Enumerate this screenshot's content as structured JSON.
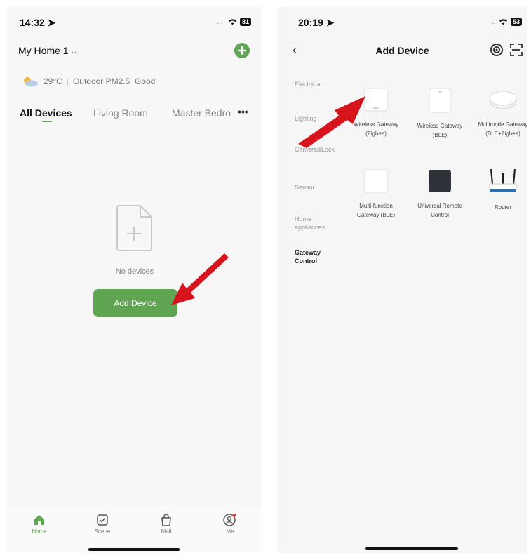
{
  "phone1": {
    "status": {
      "time": "14:32",
      "signal": "....",
      "battery": "81"
    },
    "home_name": "My Home 1",
    "weather": {
      "temperature": "29°C",
      "air_quality": "Outdoor PM2.5  Good"
    },
    "tabs": [
      "All Devices",
      "Living Room",
      "Master Bedro"
    ],
    "empty_text": "No devices",
    "add_device_label": "Add Device",
    "nav": [
      "Home",
      "Scene",
      "Mall",
      "Me"
    ]
  },
  "phone2": {
    "status": {
      "time": "20:19",
      "battery": "53"
    },
    "title": "Add Device",
    "categories": [
      "Electrician",
      "Lighting",
      "Camera&Lock",
      "Sensor",
      "Home appliances",
      "Gateway Control"
    ],
    "devices": [
      "Wireless Gateway (Zigbee)",
      "Wireless Gateway (BLE)",
      "Multimode Gateway (BLE+Zigbee)",
      "Multi-function Gateway (BLE)",
      "Universal Remote Control",
      "Router"
    ]
  },
  "colors": {
    "accent_green": "#5fa552",
    "arrow_red": "#d7141c"
  }
}
